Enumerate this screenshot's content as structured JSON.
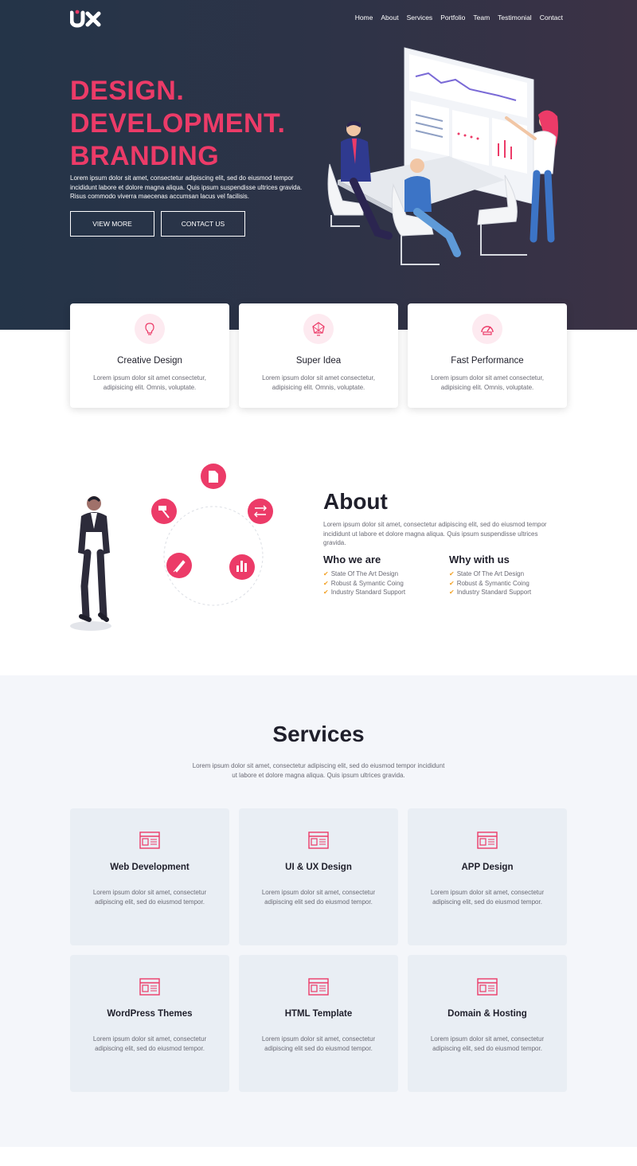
{
  "colors": {
    "accent": "#ec3b68",
    "hero_bg": "#2b3447",
    "check": "#f2a32a",
    "services_bg": "#f4f6fa",
    "card_bg": "#e9eef4"
  },
  "nav": {
    "items": [
      "Home",
      "About",
      "Services",
      "Portfolio",
      "Team",
      "Testimonial",
      "Contact"
    ]
  },
  "hero": {
    "headline": [
      "DESIGN.",
      "DEVELOPMENT.",
      "BRANDING"
    ],
    "text": "Lorem ipsum dolor sit amet, consectetur adipiscing elit, sed do eiusmod tempor incididunt labore et dolore magna aliqua. Quis ipsum suspendisse ultrices gravida. Risus commodo viverra maecenas accumsan lacus vel facilisis.",
    "view_more": "VIEW MORE",
    "contact_us": "CONTACT US"
  },
  "features": [
    {
      "icon": "lightbulb-icon",
      "title": "Creative Design",
      "text": "Lorem ipsum dolor sit amet consectetur, adipisicing elit. Omnis, voluptate."
    },
    {
      "icon": "idea-icon",
      "title": "Super Idea",
      "text": "Lorem ipsum dolor sit amet consectetur, adipisicing elit. Omnis, voluptate."
    },
    {
      "icon": "speedometer-icon",
      "title": "Fast Performance",
      "text": "Lorem ipsum dolor sit amet consectetur, adipisicing elit. Omnis, voluptate."
    }
  ],
  "about": {
    "title": "About",
    "text": "Lorem ipsum dolor sit amet, consectetur adipiscing elit, sed do eiusmod tempor incididunt ut labore et dolore magna aliqua. Quis ipsum suspendisse ultrices gravida.",
    "who_title": "Who we are",
    "who_items": [
      "State Of The Art Design",
      "Robust & Symantic Coing",
      "Industry Standard Support"
    ],
    "why_title": "Why with us",
    "why_items": [
      "State Of The Art Design",
      "Robust & Symantic Coing",
      "Industry Standard Support"
    ]
  },
  "services": {
    "title": "Services",
    "intro": "Lorem ipsum dolor sit amet, consectetur adipiscing elit, sed do eiusmod tempor incididunt ut labore et dolore magna aliqua. Quis ipsum ultrices gravida.",
    "items": [
      {
        "title": "Web Development",
        "text": "Lorem ipsum dolor sit amet, consectetur adipiscing elit, sed do eiusmod tempor."
      },
      {
        "title": "UI & UX Design",
        "text": "Lorem ipsum dolor sit amet, consectetur adipiscing elit sed do eiusmod tempor."
      },
      {
        "title": "APP Design",
        "text": "Lorem ipsum dolor sit amet, consectetur adipiscing elit, sed do eiusmod tempor."
      },
      {
        "title": "WordPress Themes",
        "text": "Lorem ipsum dolor sit amet, consectetur adipiscing elit, sed do eiusmod tempor."
      },
      {
        "title": "HTML Template",
        "text": "Lorem ipsum dolor sit amet, consectetur adipiscing elit sed do eiusmod tempor."
      },
      {
        "title": "Domain & Hosting",
        "text": "Lorem ipsum dolor sit amet, consectetur adipiscing elit, sed do eiusmod tempor."
      }
    ]
  }
}
